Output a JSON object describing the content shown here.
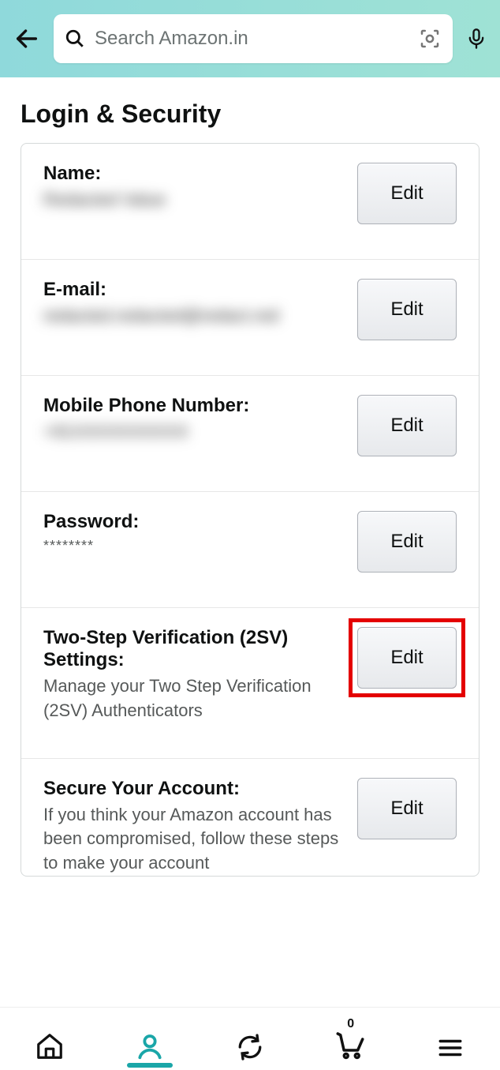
{
  "header": {
    "search_placeholder": "Search Amazon.in"
  },
  "page": {
    "title": "Login & Security"
  },
  "rows": {
    "name": {
      "label": "Name:",
      "value": "Redacted Value",
      "edit": "Edit"
    },
    "email": {
      "label": "E-mail:",
      "value": "redacted.redacted@redact.red",
      "edit": "Edit"
    },
    "mobile": {
      "label": "Mobile Phone Number:",
      "value": "+91XXXXXXXXXX",
      "edit": "Edit"
    },
    "password": {
      "label": "Password:",
      "value": "********",
      "edit": "Edit"
    },
    "twosv": {
      "label": "Two-Step Verification (2SV) Settings:",
      "value": "Manage your Two Step Verification (2SV) Authenticators",
      "edit": "Edit"
    },
    "secure": {
      "label": "Secure Your Account:",
      "value": "If you think your Amazon account has been compromised, follow these steps to make your account",
      "edit": "Edit"
    }
  },
  "nav": {
    "cart_count": "0"
  }
}
